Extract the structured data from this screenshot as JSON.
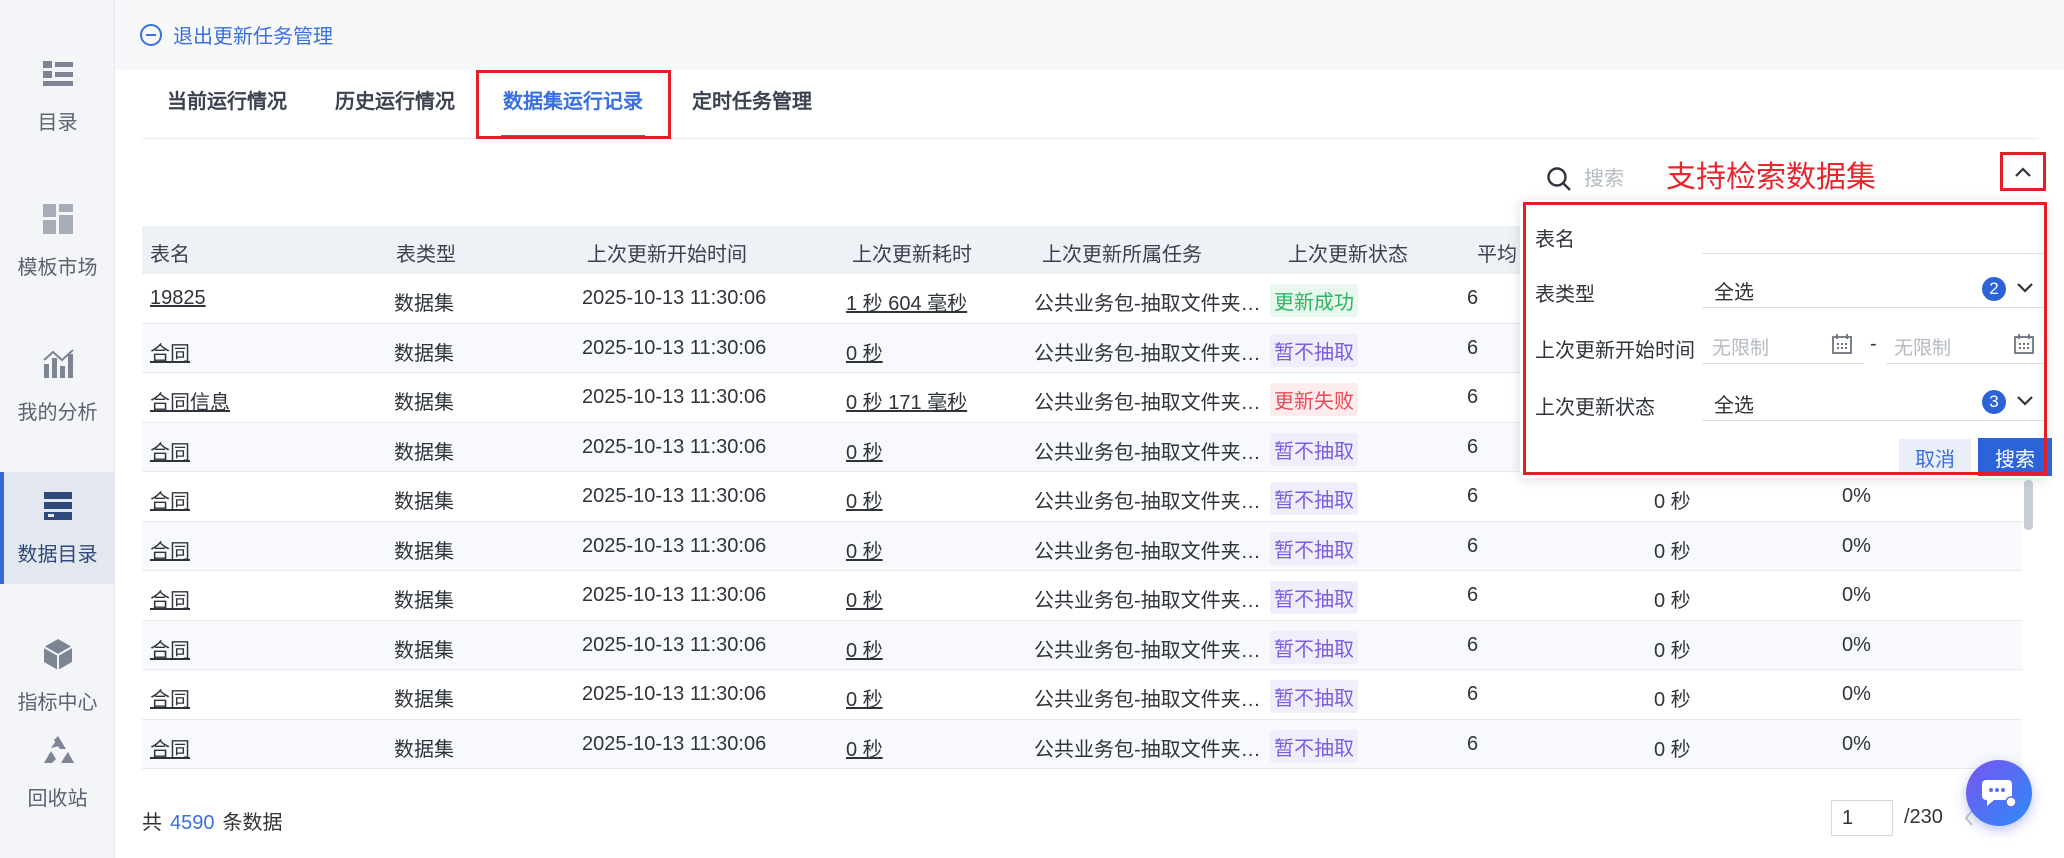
{
  "sidebar": {
    "items": [
      {
        "label": "目录",
        "icon": "list-icon"
      },
      {
        "label": "模板市场",
        "icon": "grid-icon"
      },
      {
        "label": "我的分析",
        "icon": "chart-icon"
      },
      {
        "label": "数据目录",
        "icon": "database-icon",
        "active": true
      },
      {
        "label": "指标中心",
        "icon": "cube-icon"
      },
      {
        "label": "回收站",
        "icon": "recycle-icon"
      }
    ]
  },
  "header": {
    "exit_label": "退出更新任务管理"
  },
  "tabs": [
    {
      "label": "当前运行情况"
    },
    {
      "label": "历史运行情况"
    },
    {
      "label": "数据集运行记录",
      "active": true
    },
    {
      "label": "定时任务管理"
    }
  ],
  "search": {
    "placeholder": "搜索",
    "annotation": "支持检索数据集"
  },
  "table": {
    "headers": [
      "表名",
      "表类型",
      "上次更新开始时间",
      "上次更新耗时",
      "上次更新所属任务",
      "上次更新状态",
      "平均"
    ],
    "rows": [
      {
        "name": "19825",
        "type": "数据集",
        "start": "2025-10-13 11:30:06",
        "duration": "1 秒 604 毫秒",
        "task": "公共业务包-抽取文件夹…",
        "status": "更新成功",
        "status_kind": "ok",
        "avg": "6",
        "c8": "",
        "c9": ""
      },
      {
        "name": "合同",
        "type": "数据集",
        "start": "2025-10-13 11:30:06",
        "duration": "0 秒",
        "task": "公共业务包-抽取文件夹…",
        "status": "暂不抽取",
        "status_kind": "pause",
        "avg": "6",
        "c8": "",
        "c9": ""
      },
      {
        "name": "合同信息",
        "type": "数据集",
        "start": "2025-10-13 11:30:06",
        "duration": "0 秒 171 毫秒",
        "task": "公共业务包-抽取文件夹…",
        "status": "更新失败",
        "status_kind": "fail",
        "avg": "6",
        "c8": "",
        "c9": ""
      },
      {
        "name": "合同",
        "type": "数据集",
        "start": "2025-10-13 11:30:06",
        "duration": "0 秒",
        "task": "公共业务包-抽取文件夹…",
        "status": "暂不抽取",
        "status_kind": "pause",
        "avg": "6",
        "c8": "",
        "c9": ""
      },
      {
        "name": "合同",
        "type": "数据集",
        "start": "2025-10-13 11:30:06",
        "duration": "0 秒",
        "task": "公共业务包-抽取文件夹…",
        "status": "暂不抽取",
        "status_kind": "pause",
        "avg": "6",
        "c8": "0 秒",
        "c9": "0%"
      },
      {
        "name": "合同",
        "type": "数据集",
        "start": "2025-10-13 11:30:06",
        "duration": "0 秒",
        "task": "公共业务包-抽取文件夹…",
        "status": "暂不抽取",
        "status_kind": "pause",
        "avg": "6",
        "c8": "0 秒",
        "c9": "0%"
      },
      {
        "name": "合同",
        "type": "数据集",
        "start": "2025-10-13 11:30:06",
        "duration": "0 秒",
        "task": "公共业务包-抽取文件夹…",
        "status": "暂不抽取",
        "status_kind": "pause",
        "avg": "6",
        "c8": "0 秒",
        "c9": "0%"
      },
      {
        "name": "合同",
        "type": "数据集",
        "start": "2025-10-13 11:30:06",
        "duration": "0 秒",
        "task": "公共业务包-抽取文件夹…",
        "status": "暂不抽取",
        "status_kind": "pause",
        "avg": "6",
        "c8": "0 秒",
        "c9": "0%"
      },
      {
        "name": "合同",
        "type": "数据集",
        "start": "2025-10-13 11:30:06",
        "duration": "0 秒",
        "task": "公共业务包-抽取文件夹…",
        "status": "暂不抽取",
        "status_kind": "pause",
        "avg": "6",
        "c8": "0 秒",
        "c9": "0%"
      },
      {
        "name": "合同",
        "type": "数据集",
        "start": "2025-10-13 11:30:06",
        "duration": "0 秒",
        "task": "公共业务包-抽取文件夹…",
        "status": "暂不抽取",
        "status_kind": "pause",
        "avg": "6",
        "c8": "0 秒",
        "c9": "0%"
      }
    ]
  },
  "footer": {
    "prefix": "共",
    "total": "4590",
    "suffix": "条数据",
    "page": "1",
    "pages": "/230"
  },
  "filter": {
    "name_label": "表名",
    "type_label": "表类型",
    "type_value": "全选",
    "type_badge": "2",
    "time_label": "上次更新开始时间",
    "time_from_placeholder": "无限制",
    "time_sep": "-",
    "time_to_placeholder": "无限制",
    "status_label": "上次更新状态",
    "status_value": "全选",
    "status_badge": "3",
    "cancel": "取消",
    "search": "搜索"
  },
  "colors": {
    "accent": "#3a6fe0",
    "annotation_red": "#e11f27",
    "ok": "#2eb463",
    "pause": "#7b5de0",
    "fail": "#e84b55"
  }
}
